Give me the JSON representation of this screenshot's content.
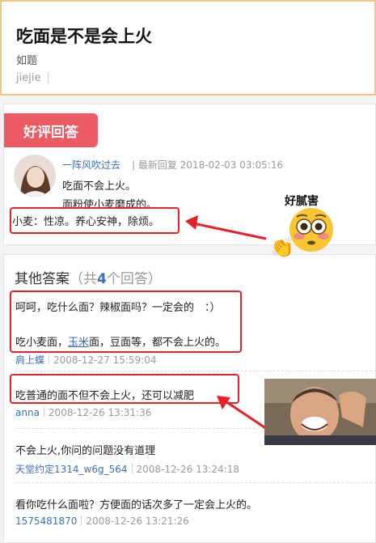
{
  "question": {
    "title": "吃面是不是会上火",
    "tag": "如题",
    "user": "jiejie"
  },
  "best_answer": {
    "badge": "好评回答",
    "user": "一阵风吹过去",
    "meta": "| 最新回复 2018-02-03 03:05:16",
    "line1": "吃面不会上火。",
    "line2": "面粉使小麦磨成的。",
    "line3": "小麦：性凉。养心安神，除烦。"
  },
  "sticker": {
    "label": "好腻害",
    "face_icon": "flushed-face-icon",
    "hand_icon": "clapping-hands-icon"
  },
  "other_answers": {
    "title": "其他答案",
    "count_prefix": "（共",
    "count": "4",
    "count_suffix": "个回答）",
    "items": [
      {
        "line1": "呵呵，吃什么面？辣椒面吗？一定会的　：）",
        "line2_a": "吃小麦面，",
        "line2_link": "玉米",
        "line2_b": "面，豆面等，都不会上火的。",
        "user": "肩上蝶",
        "date": "2008-12-27 15:59:04"
      },
      {
        "line1": "吃普通的面不但不会上火，还可以减肥",
        "user": "anna",
        "date": "2008-12-26 13:31:36"
      },
      {
        "line1": "不会上火,你问的问题没有道理",
        "user": "天堂约定1314_w6g_564",
        "date": "2008-12-26 13:24:18"
      },
      {
        "line1": "看你吃什么面啦？方便面的话次多了一定会上火的。",
        "user": "1575481870",
        "date": "2008-12-26 13:21:26"
      }
    ]
  },
  "colors": {
    "accent_red": "#e8202a",
    "badge_red": "#ec5b63",
    "link_blue": "#3d6fb6",
    "question_border": "#f0c780"
  }
}
